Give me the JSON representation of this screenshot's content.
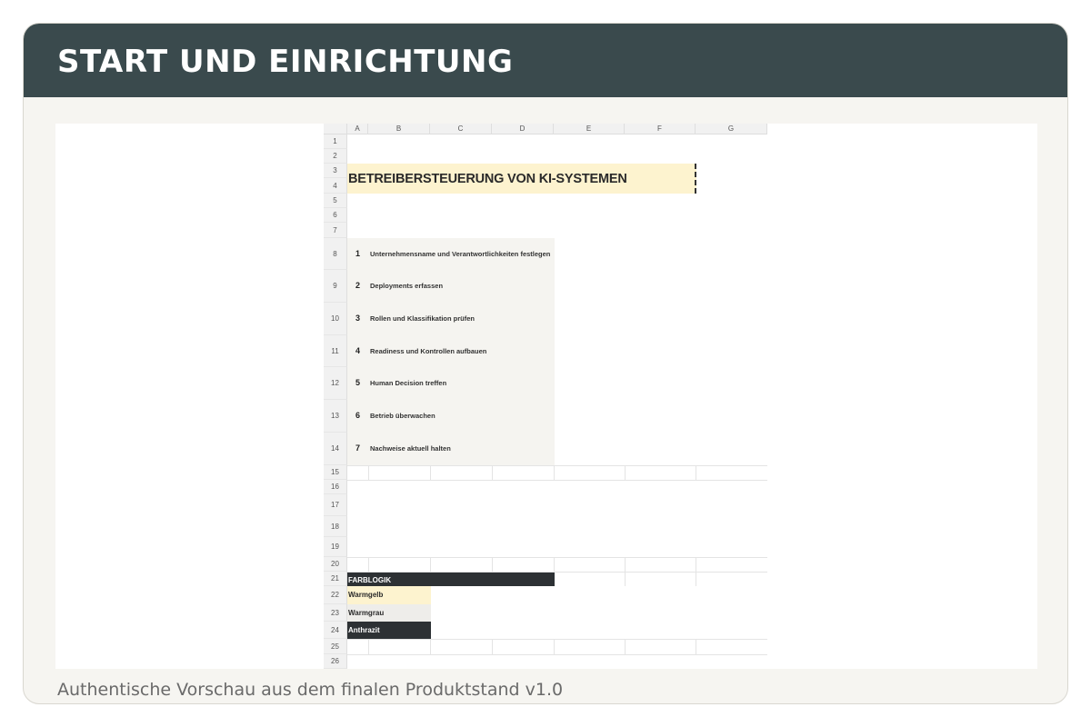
{
  "header": {
    "title": "START UND EINRICHTUNG"
  },
  "caption": "Authentische Vorschau aus dem finalen Produktstand v1.0",
  "sheet": {
    "columns": [
      "A",
      "B",
      "C",
      "D",
      "E",
      "F",
      "G"
    ],
    "rows": [
      "1",
      "2",
      "3",
      "4",
      "5",
      "6",
      "7",
      "8",
      "9",
      "10",
      "11",
      "12",
      "13",
      "14",
      "15",
      "16",
      "17",
      "18",
      "19",
      "20",
      "21",
      "22",
      "23",
      "24",
      "25",
      "26"
    ],
    "title": "BETREIBERSTEUERUNG VON KI-SYSTEMEN",
    "steps": [
      {
        "num": "1",
        "label": "Unternehmensname und Verantwortlichkeiten festlegen"
      },
      {
        "num": "2",
        "label": "Deployments erfassen"
      },
      {
        "num": "3",
        "label": "Rollen und Klassifikation prüfen"
      },
      {
        "num": "4",
        "label": "Readiness und Kontrollen aufbauen"
      },
      {
        "num": "5",
        "label": "Human Decision treffen"
      },
      {
        "num": "6",
        "label": "Betrieb überwachen"
      },
      {
        "num": "7",
        "label": "Nachweise aktuell halten"
      }
    ],
    "legend": {
      "title": "FARBLOGIK",
      "items": [
        {
          "label": "Warmgelb",
          "color": "#fdf3cf",
          "text_color": "#2a2a2a"
        },
        {
          "label": "Warmgrau",
          "color": "#eeedea",
          "text_color": "#2a2a2a"
        },
        {
          "label": "Anthrazit",
          "color": "#2d3134",
          "text_color": "#ffffff"
        }
      ]
    }
  },
  "colors": {
    "header_bg": "#3a4a4d",
    "card_bg": "#f6f5f1",
    "warmgelb": "#fdf3cf",
    "warmgrau": "#f5f4f0",
    "anthrazit": "#2d3134"
  }
}
